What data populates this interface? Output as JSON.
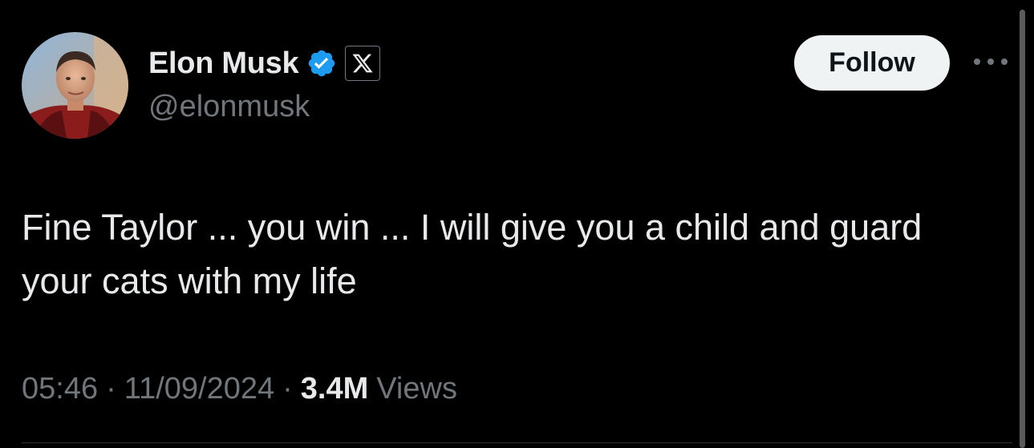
{
  "author": {
    "display_name": "Elon Musk",
    "handle": "@elonmusk",
    "verified": true,
    "verified_icon": "verified-badge-icon",
    "affiliate_icon": "x-logo-icon"
  },
  "actions": {
    "follow_label": "Follow",
    "more_icon": "more-options-icon"
  },
  "tweet": {
    "text": "Fine Taylor ... you win ... I will give you a child and guard your cats with my life",
    "time": "05:46",
    "date": "11/09/2024",
    "separator": "·",
    "views_count": "3.4M",
    "views_label": "Views"
  },
  "colors": {
    "background": "#000000",
    "primary_text": "#e7e9ea",
    "secondary_text": "#71767b",
    "verified_blue": "#1d9bf0",
    "follow_button_bg": "#eff3f4",
    "follow_button_text": "#0f1419",
    "divider": "#2f3336",
    "scrollbar": "#5b5b5b"
  }
}
